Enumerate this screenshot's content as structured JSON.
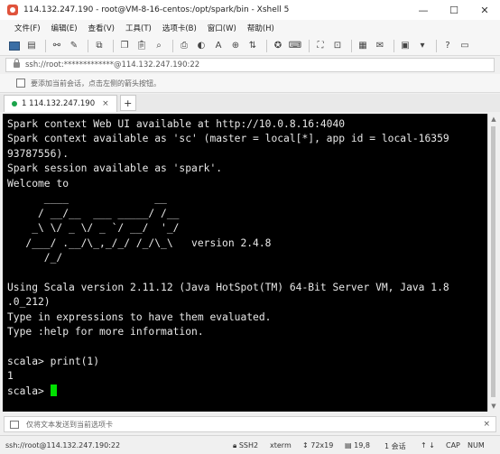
{
  "window": {
    "title": "114.132.247.190 - root@VM-8-16-centos:/opt/spark/bin - Xshell 5",
    "minimize": "—",
    "maximize": "☐",
    "close": "✕"
  },
  "menu": [
    "文件(F)",
    "编辑(E)",
    "查看(V)",
    "工具(T)",
    "选项卡(B)",
    "窗口(W)",
    "帮助(H)"
  ],
  "address": {
    "text": "ssh://root:*************@114.132.247.190:22"
  },
  "hint": {
    "text": "要添加当前会话，点击左侧的箭头按钮。"
  },
  "tab": {
    "label": "1 114.132.247.190",
    "close": "×",
    "add": "+"
  },
  "terminal": {
    "lines": [
      "Spark context Web UI available at http://10.0.8.16:4040",
      "Spark context available as 'sc' (master = local[*], app id = local-16359",
      "93787556).",
      "Spark session available as 'spark'.",
      "Welcome to",
      "      ____              __",
      "     / __/__  ___ _____/ /__",
      "    _\\ \\/ _ \\/ _ `/ __/  '_/",
      "   /___/ .__/\\_,_/_/ /_/\\_\\   version 2.4.8",
      "      /_/",
      "",
      "Using Scala version 2.11.12 (Java HotSpot(TM) 64-Bit Server VM, Java 1.8",
      ".0_212)",
      "Type in expressions to have them evaluated.",
      "Type :help for more information.",
      "",
      "scala> print(1)",
      "1"
    ],
    "prompt": "scala> "
  },
  "sendbar": {
    "text": "仅将文本发送到当前选项卡",
    "close": "×"
  },
  "status": {
    "connection": "ssh://root@114.132.247.190:22",
    "protocol": "SSH2",
    "terminal": "xterm",
    "size": "72x19",
    "position": "19,8",
    "sessions": "1 会话",
    "caps": "CAP",
    "num": "NUM"
  }
}
